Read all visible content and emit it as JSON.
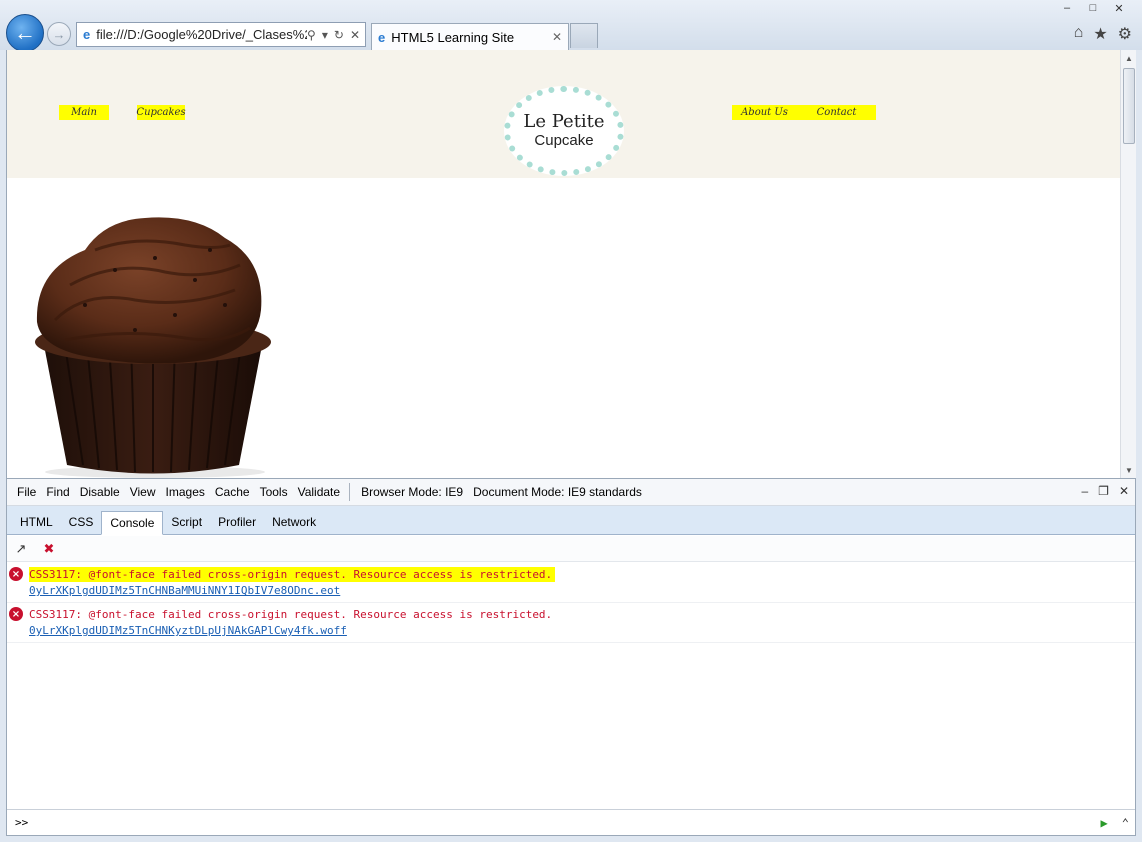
{
  "browser": {
    "address": "file:///D:/Google%20Drive/_Clases%2",
    "active_tab": "HTML5 Learning Site",
    "window_buttons": [
      "–",
      "□",
      "✕"
    ]
  },
  "site": {
    "nav": [
      "Main",
      "Cupcakes",
      "About Us",
      "Contact"
    ],
    "logo_line1": "Le Petite",
    "logo_line2": "Cupcake"
  },
  "devtools": {
    "menu": [
      "File",
      "Find",
      "Disable",
      "View",
      "Images",
      "Cache",
      "Tools",
      "Validate"
    ],
    "browser_mode": "Browser Mode: IE9",
    "document_mode": "Document Mode: IE9 standards",
    "tabs": [
      "HTML",
      "CSS",
      "Console",
      "Script",
      "Profiler",
      "Network"
    ],
    "active_tab": "Console",
    "console": [
      {
        "message": "CSS3117: @font-face failed cross-origin request. Resource access is restricted.",
        "source": "0yLrXKplgdUDIMz5TnCHNBaMMUiNNY1IQbIV7e8ODnc.eot"
      },
      {
        "message": "CSS3117: @font-face failed cross-origin request. Resource access is restricted.",
        "source": "0yLrXKplgdUDIMz5TnCHNKyztDLpUjNAkGAPlCwy4fk.woff"
      }
    ],
    "prompt": ">>"
  },
  "colors": {
    "highlight": "#ffff00",
    "error": "#c8102e",
    "header_bg": "#f6f3eb",
    "logo_border": "#a9ddd4"
  }
}
